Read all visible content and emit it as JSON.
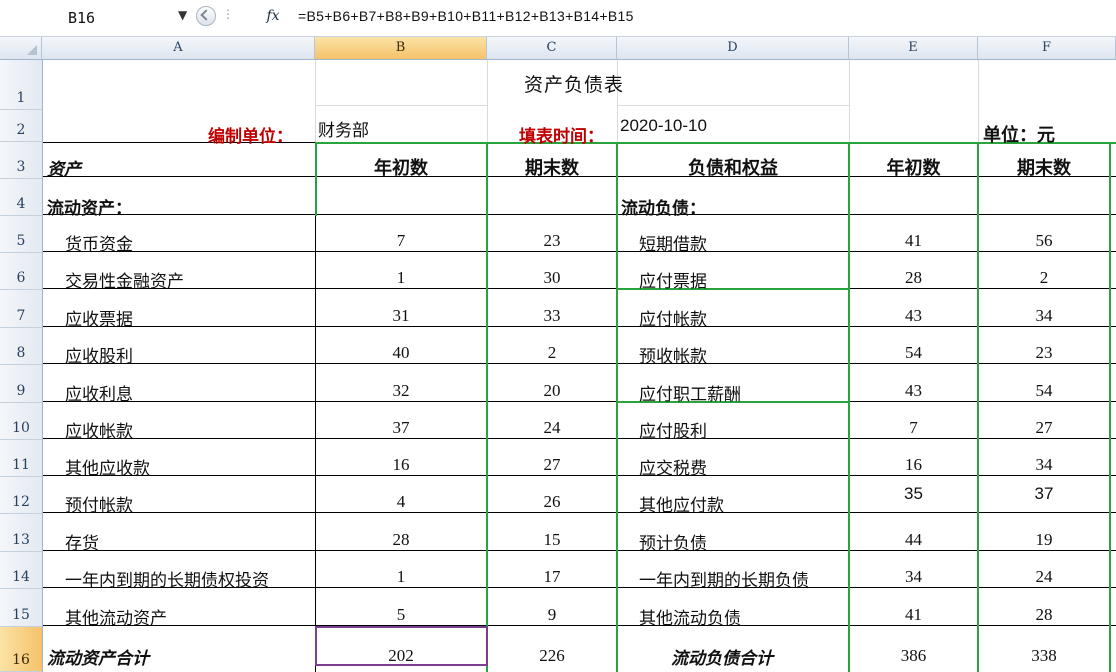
{
  "formula_bar": {
    "name_box": "B16",
    "fx_label": "fx",
    "formula": "=B5+B6+B7+B8+B9+B10+B11+B12+B13+B14+B15"
  },
  "columns": [
    "A",
    "B",
    "C",
    "D",
    "E",
    "F"
  ],
  "rows": [
    "1",
    "2",
    "3",
    "4",
    "5",
    "6",
    "7",
    "8",
    "9",
    "10",
    "11",
    "12",
    "13",
    "14",
    "15",
    "16"
  ],
  "selected_cell": "B16",
  "sheet": {
    "title": "资产负债表",
    "org_label": "编制单位：",
    "org_value": "财务部",
    "date_label": "填表时间：",
    "date_value": "2020-10-10",
    "unit_label": "单位：元",
    "headers": {
      "assets": "资产",
      "begin": "年初数",
      "end": "期末数",
      "liab": "负债和权益",
      "begin2": "年初数",
      "end2": "期末数"
    },
    "section_assets": "流动资产：",
    "section_liab": "流动负债：",
    "items": [
      {
        "asset": "货币资金",
        "a_begin": "7",
        "a_end": "23",
        "liab": "短期借款",
        "l_begin": "41",
        "l_end": "56"
      },
      {
        "asset": "交易性金融资产",
        "a_begin": "1",
        "a_end": "30",
        "liab": "应付票据",
        "l_begin": "28",
        "l_end": "2"
      },
      {
        "asset": "应收票据",
        "a_begin": "31",
        "a_end": "33",
        "liab": "应付帐款",
        "l_begin": "43",
        "l_end": "34"
      },
      {
        "asset": "应收股利",
        "a_begin": "40",
        "a_end": "2",
        "liab": "预收帐款",
        "l_begin": "54",
        "l_end": "23"
      },
      {
        "asset": "应收利息",
        "a_begin": "32",
        "a_end": "20",
        "liab": "应付职工薪酬",
        "l_begin": "43",
        "l_end": "54"
      },
      {
        "asset": "应收帐款",
        "a_begin": "37",
        "a_end": "24",
        "liab": "应付股利",
        "l_begin": "7",
        "l_end": "27"
      },
      {
        "asset": "其他应收款",
        "a_begin": "16",
        "a_end": "27",
        "liab": "应交税费",
        "l_begin": "16",
        "l_end": "34"
      },
      {
        "asset": "预付帐款",
        "a_begin": "4",
        "a_end": "26",
        "liab": "其他应付款",
        "l_begin": "35",
        "l_end": "37"
      },
      {
        "asset": "存货",
        "a_begin": "28",
        "a_end": "15",
        "liab": "预计负债",
        "l_begin": "44",
        "l_end": "19"
      },
      {
        "asset": "一年内到期的长期债权投资",
        "a_begin": "1",
        "a_end": "17",
        "liab": "一年内到期的长期负债",
        "l_begin": "34",
        "l_end": "24"
      },
      {
        "asset": "其他流动资产",
        "a_begin": "5",
        "a_end": "9",
        "liab": "其他流动负债",
        "l_begin": "41",
        "l_end": "28"
      }
    ],
    "total": {
      "asset": "流动资产合计",
      "a_begin": "202",
      "a_end": "226",
      "liab": "流动负债合计",
      "l_begin": "386",
      "l_end": "338"
    }
  },
  "colors": {
    "green_border": "#2aa33c",
    "red_label": "#c00000",
    "selection": "#7a3f8f",
    "header_highlight": "#f5c26a"
  }
}
